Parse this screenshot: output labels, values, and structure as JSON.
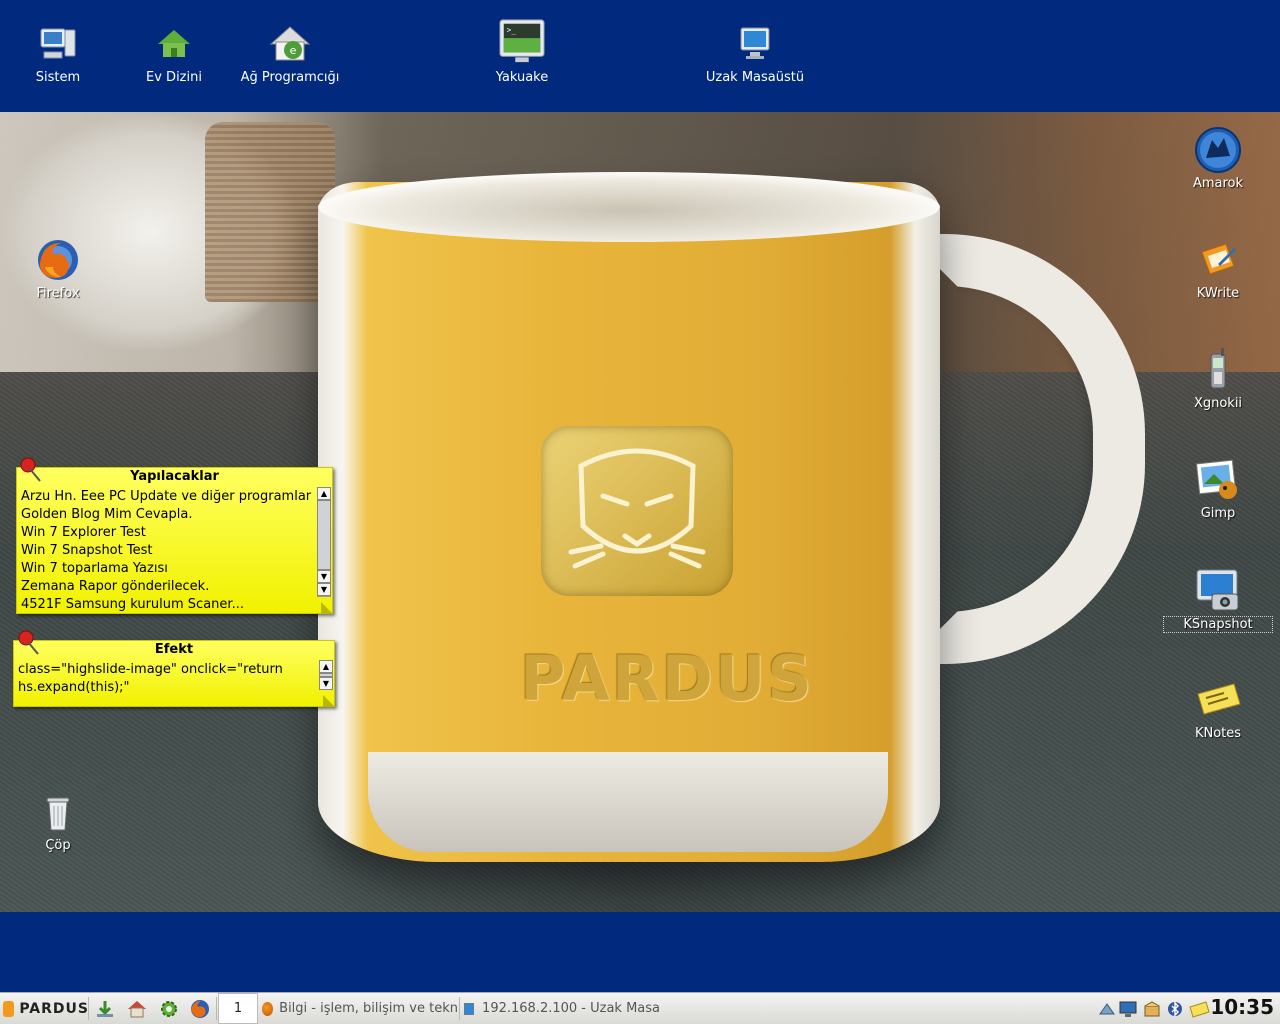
{
  "desktop": {
    "top_icons": [
      {
        "label": "Sistem",
        "icon": "computer-system-icon"
      },
      {
        "label": "Ev Dizini",
        "icon": "home-folder-icon"
      },
      {
        "label": "Ağ Programcığı",
        "icon": "network-home-icon"
      },
      {
        "label": "Yakuake",
        "icon": "terminal-monitor-icon"
      },
      {
        "label": "Uzak Masaüstü",
        "icon": "remote-desktop-icon"
      }
    ],
    "right_icons": [
      {
        "label": "Amarok",
        "icon": "amarok-wolf-icon"
      },
      {
        "label": "KWrite",
        "icon": "kwrite-pen-icon"
      },
      {
        "label": "Xgnokii",
        "icon": "mobile-phone-icon"
      },
      {
        "label": "Gimp",
        "icon": "gimp-icon"
      },
      {
        "label": "KSnapshot",
        "icon": "camera-monitor-icon"
      },
      {
        "label": "KNotes",
        "icon": "sticky-note-icon"
      }
    ],
    "left_icons": [
      {
        "label": "Firefox",
        "icon": "firefox-icon"
      },
      {
        "label": "Çöp",
        "icon": "trash-icon"
      }
    ],
    "wallpaper_brand": "PARDUS"
  },
  "notes": [
    {
      "title": "Yapılacaklar",
      "lines": [
        "Arzu Hn. Eee PC Update ve diğer programlar",
        "Golden Blog Mim Cevapla.",
        "Win 7 Explorer Test",
        "Win 7 Snapshot Test",
        "Win 7 toparlama Yazısı",
        "Zemana Rapor gönderilecek.",
        "4521F Samsung kurulum Scaner..."
      ]
    },
    {
      "title": "Efekt",
      "lines": [
        "class=\"highslide-image\" onclick=\"return",
        "hs.expand(this);\""
      ]
    }
  ],
  "taskbar": {
    "start_label": "PARDUS",
    "quicklaunch": [
      "download-icon",
      "home-icon",
      "settings-gear-icon",
      "firefox-icon"
    ],
    "desktop_number": "1",
    "tasks": [
      {
        "label": "Bilgi - işlem, bilişim ve tekn",
        "icon": "firefox-icon"
      },
      {
        "label": "192.168.2.100 - Uzak Masa",
        "icon": "remote-desktop-icon"
      }
    ],
    "tray": [
      "network-icon",
      "monitor-icon",
      "package-icon",
      "bluetooth-icon",
      "knotes-tray-icon"
    ],
    "clock": "10:35"
  },
  "colors": {
    "panel_blue": "#01297d",
    "note_yellow": "#ffff40"
  }
}
